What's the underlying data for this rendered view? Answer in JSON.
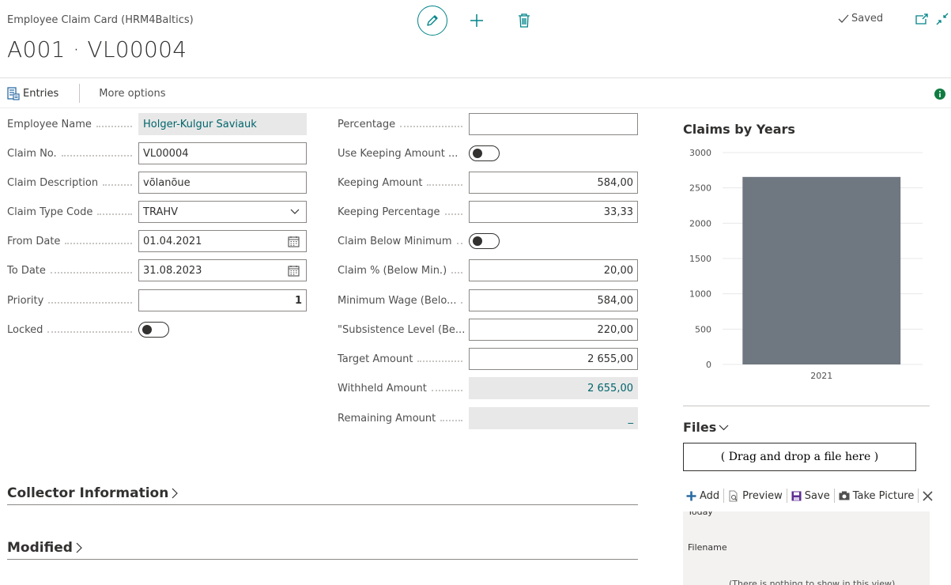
{
  "header": {
    "caption": "Employee Claim Card (HRM4Baltics)",
    "title": "A001 · VL00004",
    "saved_label": "Saved"
  },
  "actionbar": {
    "entries_label": "Entries",
    "more_label": "More options"
  },
  "general_left": [
    {
      "label": "Employee Name",
      "value": "Holger-Kulgur Saviauk",
      "type": "readonly-link"
    },
    {
      "label": "Claim No.",
      "value": "VL00004",
      "type": "text"
    },
    {
      "label": "Claim Description",
      "value": "võlanõue",
      "type": "text"
    },
    {
      "label": "Claim Type Code",
      "value": "TRAHV",
      "type": "select"
    },
    {
      "label": "From Date",
      "value": "01.04.2021",
      "type": "date"
    },
    {
      "label": "To Date",
      "value": "31.08.2023",
      "type": "date"
    },
    {
      "label": "Priority",
      "value": "1",
      "type": "number"
    },
    {
      "label": "Locked",
      "value": "off",
      "type": "toggle"
    }
  ],
  "general_right": [
    {
      "label": "Percentage",
      "value": "",
      "type": "number"
    },
    {
      "label": "Use Keeping Amount ...",
      "value": "off",
      "type": "toggle"
    },
    {
      "label": "Keeping Amount",
      "value": "584,00",
      "type": "number"
    },
    {
      "label": "Keeping Percentage",
      "value": "33,33",
      "type": "number"
    },
    {
      "label": "Claim Below Minimum",
      "value": "off",
      "type": "toggle"
    },
    {
      "label": "Claim % (Below Min.)",
      "value": "20,00",
      "type": "number"
    },
    {
      "label": "Minimum Wage (Belo...",
      "value": "584,00",
      "type": "number"
    },
    {
      "label": "\"Subsistence Level (Be...",
      "value": "220,00",
      "type": "number"
    },
    {
      "label": "Target Amount",
      "value": "2 655,00",
      "type": "number"
    },
    {
      "label": "Withheld Amount",
      "value": "2 655,00",
      "type": "readonly-link"
    },
    {
      "label": "Remaining Amount",
      "value": "_",
      "type": "readonly-link"
    }
  ],
  "sections": {
    "collector": "Collector Information",
    "modified": "Modified"
  },
  "chart_data": {
    "type": "bar",
    "title": "Claims by Years",
    "categories": [
      "2021"
    ],
    "values": [
      2655
    ],
    "ylim": [
      0,
      3000
    ],
    "yticks": [
      "0",
      "500",
      "1000",
      "1500",
      "2000",
      "2500",
      "3000"
    ],
    "grid": true,
    "bar_color": "#6f7780"
  },
  "files": {
    "title": "Files",
    "dropzone": "( Drag and drop a file here )",
    "toolbar": {
      "add": "Add",
      "preview": "Preview",
      "save": "Save",
      "take_picture": "Take Picture"
    },
    "column_header": "Filename",
    "empty_text": "(There is nothing to show in this view)"
  },
  "colors": {
    "accent": "#008489",
    "link": "#00656b",
    "info": "#107c41"
  }
}
